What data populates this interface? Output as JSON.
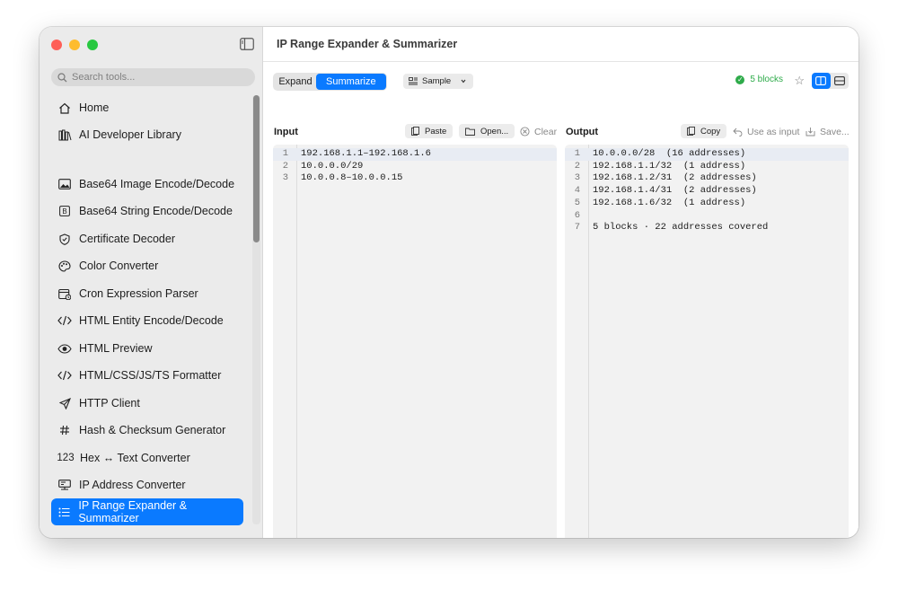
{
  "sidebar": {
    "search_placeholder": "Search tools...",
    "items": [
      {
        "label": "Home",
        "icon": "home-icon"
      },
      {
        "label": "AI Developer Library",
        "icon": "library-icon"
      },
      {
        "label": "Base64 Image Encode/Decode",
        "icon": "image-icon"
      },
      {
        "label": "Base64 String Encode/Decode",
        "icon": "b-icon"
      },
      {
        "label": "Certificate Decoder",
        "icon": "shield-check-icon"
      },
      {
        "label": "Color Converter",
        "icon": "palette-icon"
      },
      {
        "label": "Cron Expression Parser",
        "icon": "calendar-icon"
      },
      {
        "label": "HTML Entity Encode/Decode",
        "icon": "code-icon"
      },
      {
        "label": "HTML Preview",
        "icon": "eye-icon"
      },
      {
        "label": "HTML/CSS/JS/TS Formatter",
        "icon": "code-icon"
      },
      {
        "label": "HTTP Client",
        "icon": "send-icon"
      },
      {
        "label": "Hash & Checksum Generator",
        "icon": "hash-icon"
      },
      {
        "label": "Hex ↔ Text Converter",
        "icon": "123-icon",
        "glyph": "123"
      },
      {
        "label": "IP Address Converter",
        "icon": "network-icon"
      },
      {
        "label": "IP Range Expander & Summarizer",
        "icon": "list-icon",
        "active": true
      }
    ]
  },
  "header": {
    "title": "IP Range Expander & Summarizer"
  },
  "toolbar": {
    "mode_options": [
      "Expand",
      "Summarize"
    ],
    "selected_mode": "Summarize",
    "sample_label": "Sample",
    "status_text": "5 blocks",
    "accent_color": "#0a7aff",
    "status_color": "#2eab4a"
  },
  "input": {
    "label": "Input",
    "paste_label": "Paste",
    "open_label": "Open...",
    "clear_label": "Clear",
    "lines": [
      "192.168.1.1–192.168.1.6",
      "10.0.0.0/29",
      "10.0.0.8–10.0.0.15"
    ]
  },
  "output": {
    "label": "Output",
    "copy_label": "Copy",
    "use_as_input_label": "Use as input",
    "save_label": "Save...",
    "lines": [
      "10.0.0.0/28  (16 addresses)",
      "192.168.1.1/32  (1 address)",
      "192.168.1.2/31  (2 addresses)",
      "192.168.1.4/31  (2 addresses)",
      "192.168.1.6/32  (1 address)",
      "",
      "5 blocks · 22 addresses covered"
    ]
  }
}
